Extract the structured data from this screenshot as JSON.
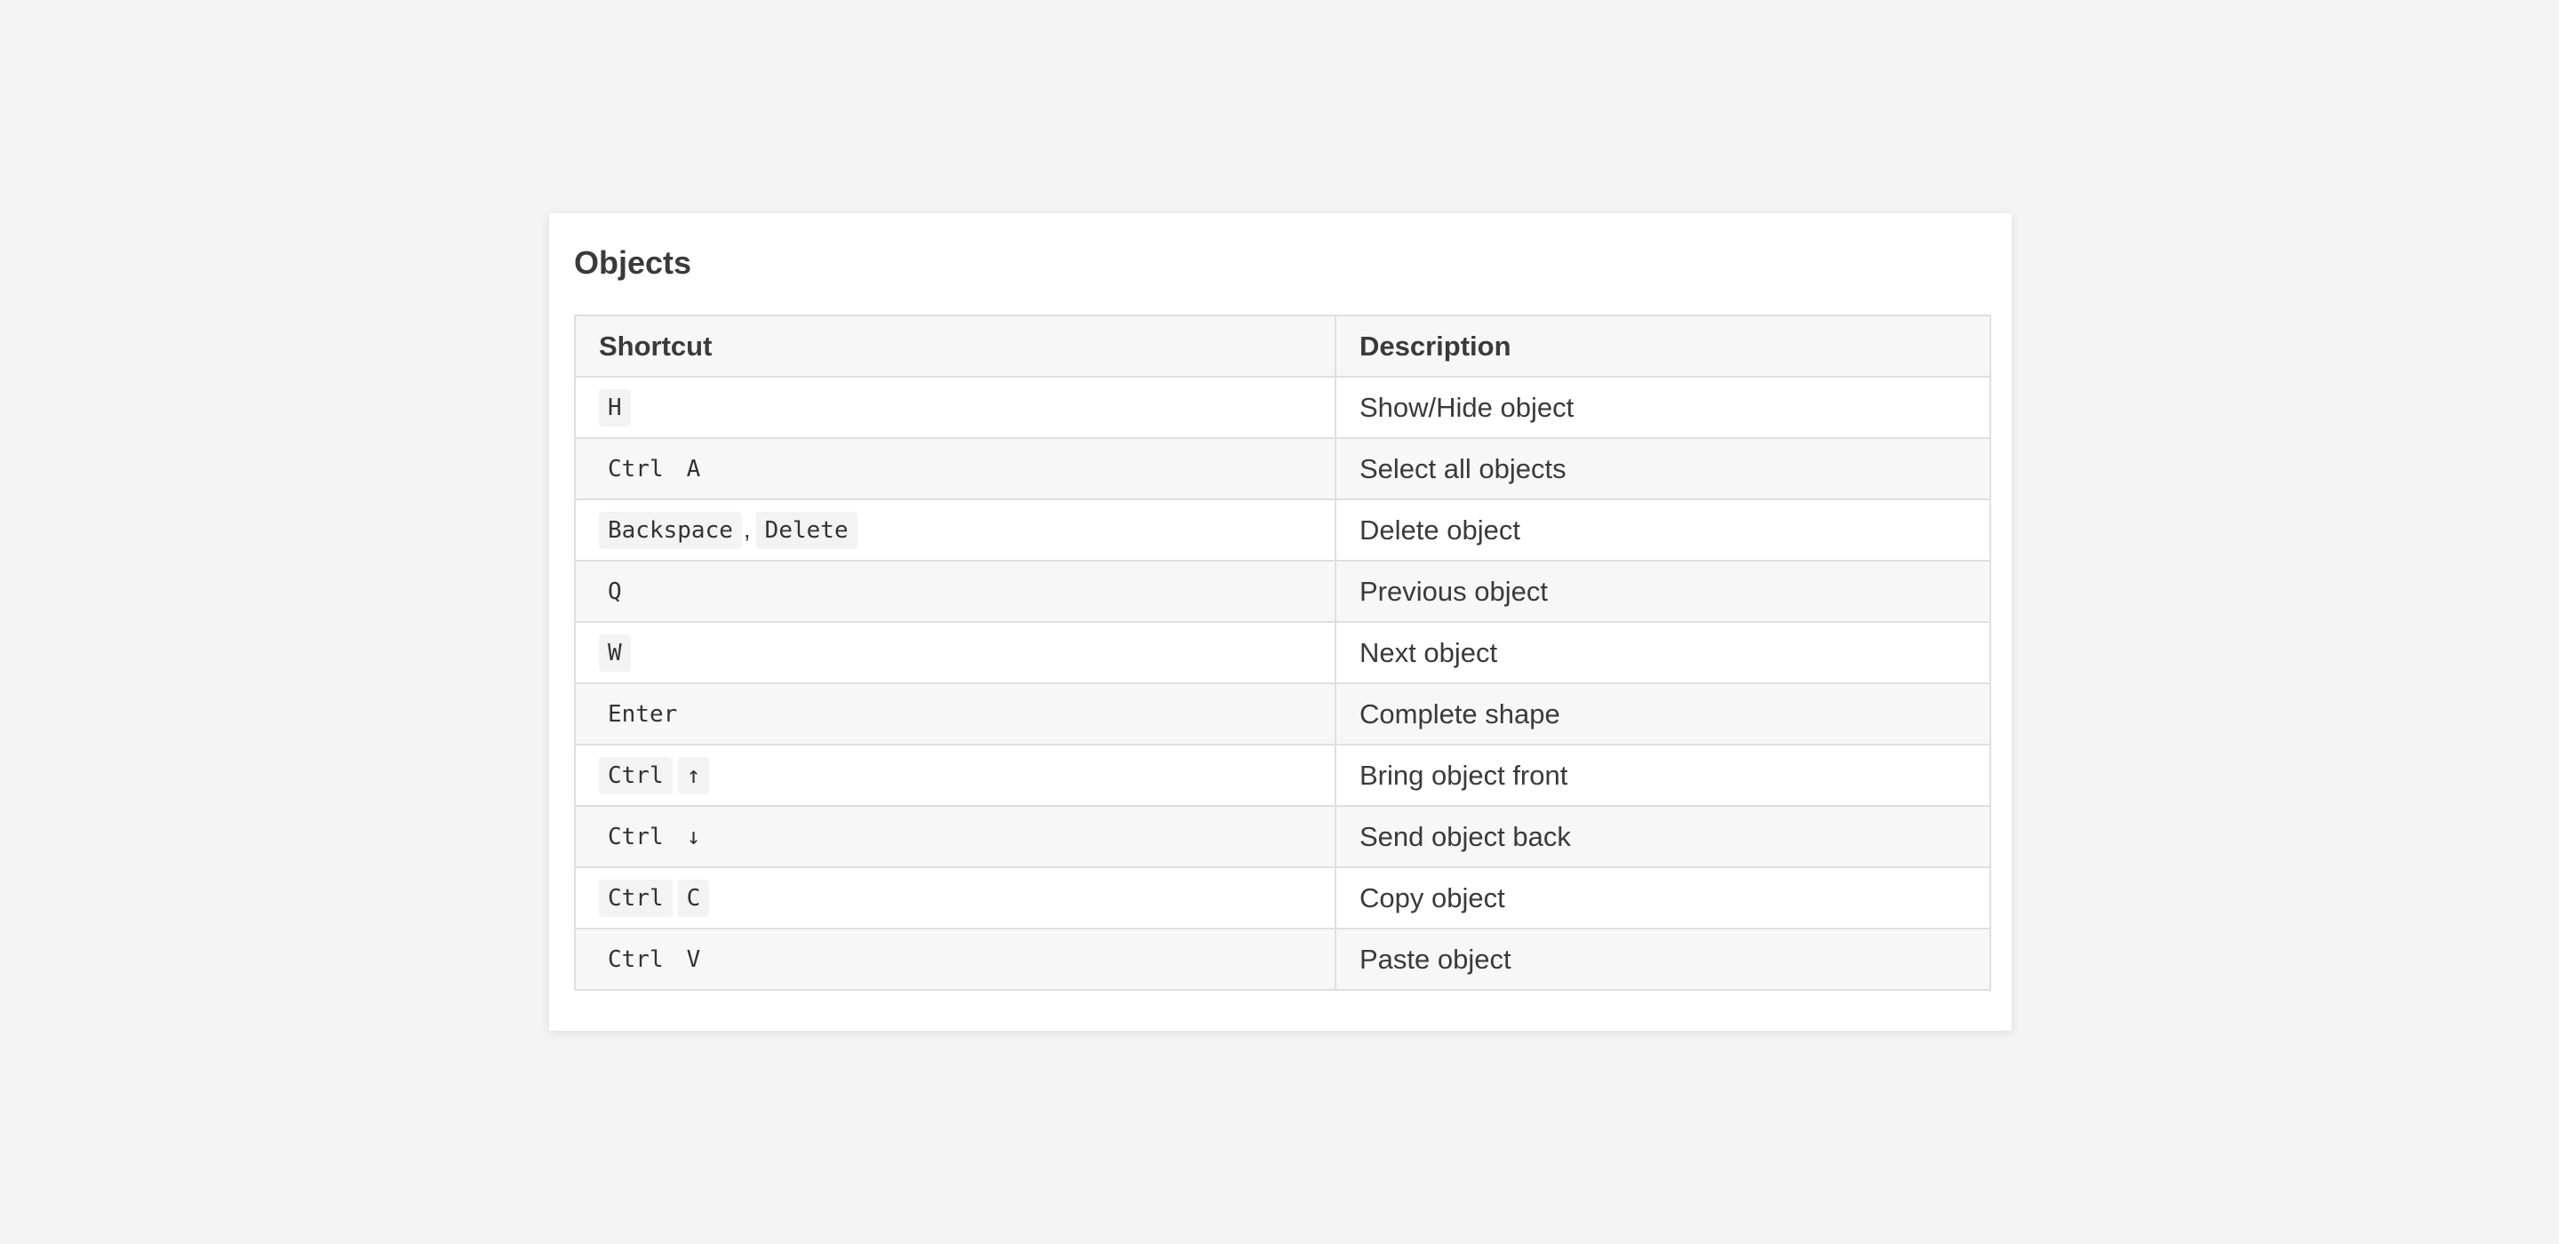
{
  "panel": {
    "title": "Objects"
  },
  "table": {
    "headers": {
      "shortcut": "Shortcut",
      "description": "Description"
    },
    "rows": [
      {
        "keys": [
          "H"
        ],
        "separator": "",
        "description": "Show/Hide object"
      },
      {
        "keys": [
          "Ctrl",
          "A"
        ],
        "separator": "",
        "description": "Select all objects"
      },
      {
        "keys": [
          "Backspace",
          "Delete"
        ],
        "separator": ",",
        "description": "Delete object"
      },
      {
        "keys": [
          "Q"
        ],
        "separator": "",
        "description": "Previous object"
      },
      {
        "keys": [
          "W"
        ],
        "separator": "",
        "description": "Next object"
      },
      {
        "keys": [
          "Enter"
        ],
        "separator": "",
        "description": "Complete shape"
      },
      {
        "keys": [
          "Ctrl",
          "↑"
        ],
        "separator": "",
        "description": "Bring object front"
      },
      {
        "keys": [
          "Ctrl",
          "↓"
        ],
        "separator": "",
        "description": "Send object back"
      },
      {
        "keys": [
          "Ctrl",
          "C"
        ],
        "separator": "",
        "description": "Copy object"
      },
      {
        "keys": [
          "Ctrl",
          "V"
        ],
        "separator": "",
        "description": "Paste object"
      }
    ]
  }
}
